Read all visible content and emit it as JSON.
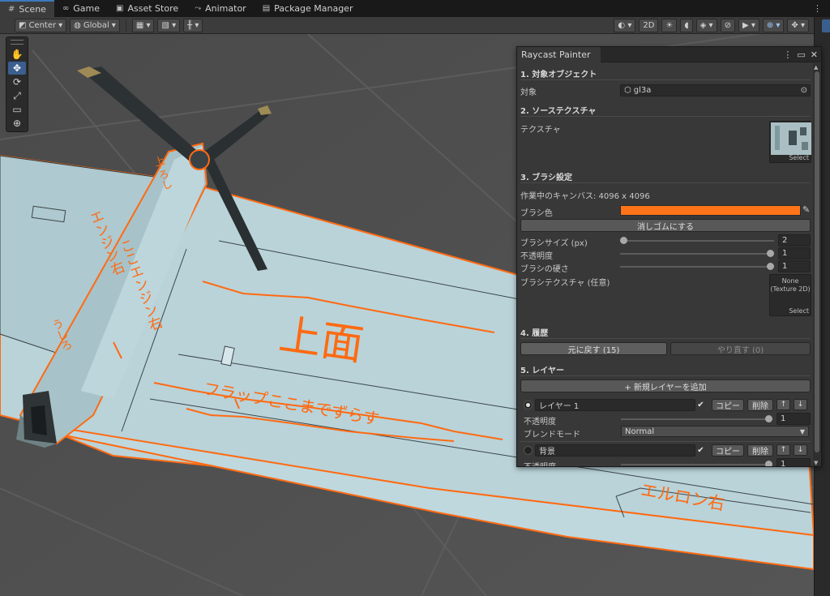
{
  "tabs": [
    {
      "icon": "#",
      "label": "Scene",
      "active": true
    },
    {
      "icon": "∞",
      "label": "Game",
      "active": false
    },
    {
      "icon": "▣",
      "label": "Asset Store",
      "active": false
    },
    {
      "icon": "⤳",
      "label": "Animator",
      "active": false
    },
    {
      "icon": "▤",
      "label": "Package Manager",
      "active": false
    }
  ],
  "toolbar": {
    "pivot": "Center",
    "space": "Global",
    "mode_2d": "2D"
  },
  "tools": [
    "✋",
    "✥",
    "⟳",
    "⤢",
    "▭",
    "⊕"
  ],
  "panel": {
    "title": "Raycast Painter",
    "s1_title": "1. 対象オブジェクト",
    "target_label": "対象",
    "target_value": "gl3a",
    "s2_title": "2. ソーステクスチャ",
    "texture_label": "テクスチャ",
    "select": "Select",
    "s3_title": "3. ブラシ設定",
    "canvas_info": "作業中のキャンバス: 4096 x 4096",
    "brush_color_label": "ブラシ色",
    "brush_color": "#ff7418",
    "eraser_button": "消しゴムにする",
    "brush_size_label": "ブラシサイズ (px)",
    "brush_size_value": "2",
    "brush_size_fraction": 0.0,
    "opacity_label": "不透明度",
    "opacity_value": "1",
    "hardness_label": "ブラシの硬さ",
    "hardness_value": "1",
    "brush_texture_label": "ブラシテクスチャ (任意)",
    "brush_texture_none": "None",
    "brush_texture_type": "(Texture 2D)",
    "s4_title": "4. 履歴",
    "undo": "元に戻す (15)",
    "redo": "やり直す (0)",
    "s5_title": "5. レイヤー",
    "add_layer": "+ 新規レイヤーを追加",
    "layers": [
      {
        "name": "レイヤー 1",
        "copy": "コピー",
        "delete": "削除",
        "up": "↑",
        "down": "↓",
        "opacity_label": "不透明度",
        "opacity": "1",
        "blend_label": "ブレンドモード",
        "blend": "Normal"
      },
      {
        "name": "背景",
        "copy": "コピー",
        "delete": "削除",
        "up": "↑",
        "down": "↓",
        "opacity_label": "不透明度",
        "opacity": "1"
      }
    ]
  },
  "scene_annotations": {
    "engine_top": "上 ろし",
    "engine_right": "エンジン右",
    "here_engine_right": "ここエンジン右",
    "back": "うしろ",
    "top_surface": "上面",
    "flap_note": "フラップここまでずらす",
    "aileron_right": "エルロン右"
  },
  "colors": {
    "accent": "#3a79bb",
    "paint": "#ff7418",
    "wing": "#b9d2d8"
  }
}
